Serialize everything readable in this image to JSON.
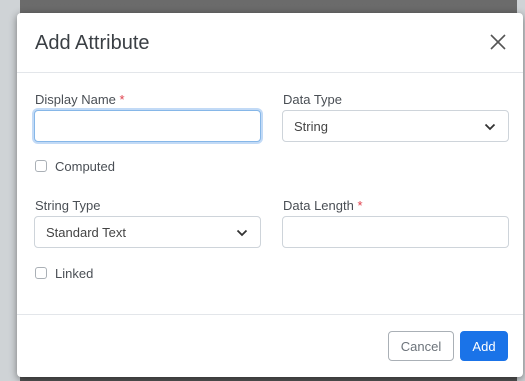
{
  "dialog": {
    "title": "Add Attribute",
    "close_icon": "close-icon"
  },
  "fields": {
    "display_name": {
      "label": "Display Name",
      "required_mark": "*",
      "value": ""
    },
    "data_type": {
      "label": "Data Type",
      "selected": "String"
    },
    "computed": {
      "label": "Computed",
      "checked": false
    },
    "string_type": {
      "label": "String Type",
      "selected": "Standard Text"
    },
    "data_length": {
      "label": "Data Length",
      "required_mark": "*",
      "value": ""
    },
    "linked": {
      "label": "Linked",
      "checked": false
    }
  },
  "footer": {
    "cancel_label": "Cancel",
    "add_label": "Add"
  },
  "colors": {
    "primary": "#1a73e8",
    "required": "#e0404c",
    "focus_ring": "#86b7e8"
  }
}
